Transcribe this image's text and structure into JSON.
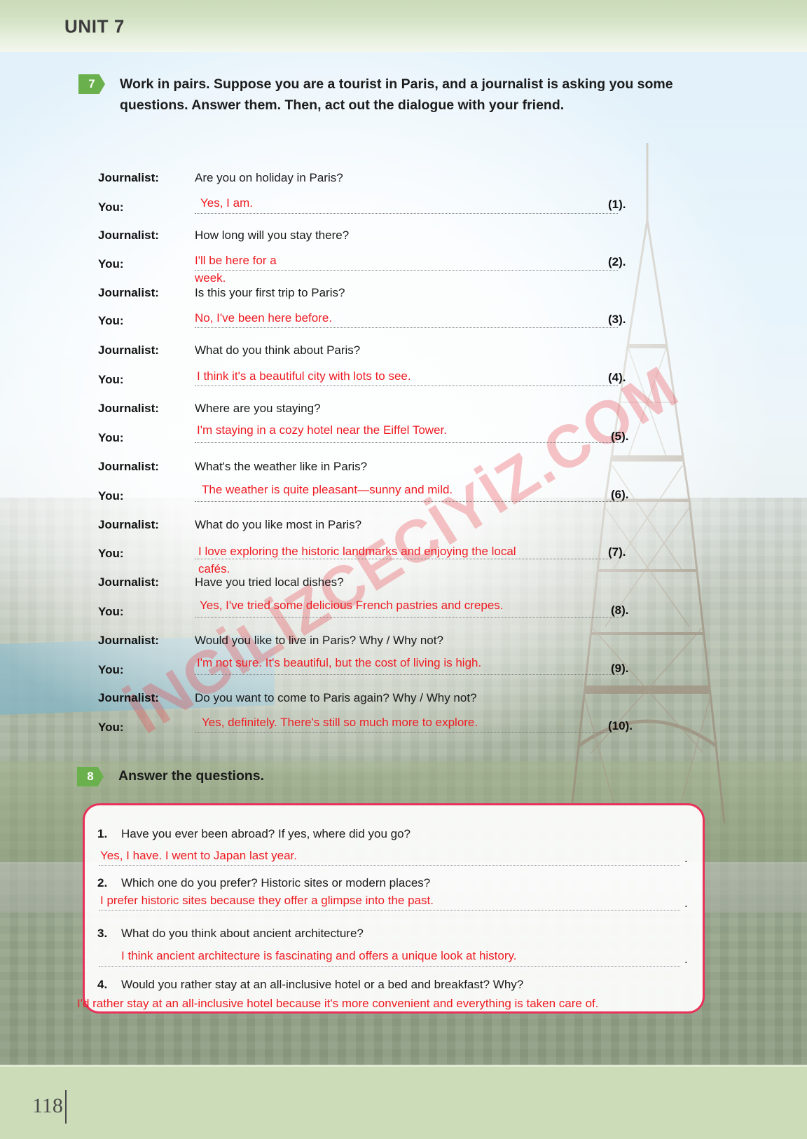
{
  "header": {
    "unit_label": "UNIT 7"
  },
  "footer": {
    "page_number": "118"
  },
  "watermark": {
    "text": "İNGİLİZCECİYİZ.COM"
  },
  "exercise7": {
    "number": "7",
    "instruction": "Work in pairs. Suppose you are a tourist in Paris, and a journalist is asking you some questions. Answer them. Then, act out the dialogue with your friend.",
    "speaker_journalist": "Journalist:",
    "speaker_you": "You:",
    "turns": [
      {
        "question": "Are you on holiday in Paris?",
        "answer": "Yes, I am.",
        "marker": "(1)."
      },
      {
        "question": "How long will you stay there?",
        "answer": "I'll be here for a",
        "answer_line2": "week.",
        "marker": "(2)."
      },
      {
        "question": "Is this your first trip to Paris?",
        "answer": "No, I've been here before.",
        "marker": "(3)."
      },
      {
        "question": "What do you think about Paris?",
        "answer": "I think it's a beautiful city with lots to see.",
        "marker": "(4)."
      },
      {
        "question": "Where are you staying?",
        "answer": "I'm staying in a cozy hotel near the Eiffel Tower.",
        "marker": "(5)."
      },
      {
        "question": "What's the weather like in Paris?",
        "answer": "The weather is quite pleasant—sunny and mild.",
        "marker": "(6)."
      },
      {
        "question": "What do you like most in Paris?",
        "answer": "I love exploring the historic landmarks and enjoying the local",
        "answer_line2": "cafés.",
        "marker": "(7)."
      },
      {
        "question": "Have you tried local dishes?",
        "answer": "Yes, I've tried some delicious French pastries and crepes.",
        "marker": "(8)."
      },
      {
        "question": "Would you like to live in Paris? Why / Why not?",
        "answer": "I'm not sure. It's beautiful, but the cost of living is high.",
        "marker": "(9)."
      },
      {
        "question": "Do you want to come to Paris again? Why / Why not?",
        "answer": "Yes, definitely. There's still so much more to explore.",
        "marker": "(10)."
      }
    ]
  },
  "exercise8": {
    "number": "8",
    "instruction": "Answer the questions.",
    "questions": [
      {
        "num": "1.",
        "text": "Have you ever been abroad? If yes, where did you go?",
        "answer": "Yes, I have. I went to Japan last year.",
        "end": "."
      },
      {
        "num": "2.",
        "text": "Which one do you prefer? Historic sites or modern places?",
        "answer": "I prefer historic sites because they offer a glimpse into the past.",
        "end": "."
      },
      {
        "num": "3.",
        "text": "What do you think about ancient architecture?",
        "answer": "I think ancient architecture is fascinating and offers a unique look at history.",
        "end": "."
      },
      {
        "num": "4.",
        "text": "Would you rather stay at an all-inclusive hotel or a bed and breakfast? Why?",
        "answer": "I'd rather stay at an all-inclusive hotel because it's more convenient and everything is taken care of.",
        "end": "."
      }
    ]
  },
  "colors": {
    "answer_red": "#ee1c22",
    "badge_green": "#6ab04c",
    "box_border_pink": "#e8325a",
    "header_green": "#cfe0bf",
    "footer_green": "#ccdcb9"
  }
}
